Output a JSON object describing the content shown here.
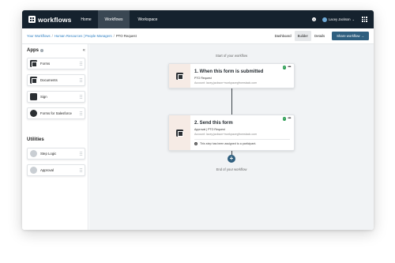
{
  "topbar": {
    "logo_text": "workflows",
    "tabs": [
      {
        "label": "Home"
      },
      {
        "label": "Workflows"
      },
      {
        "label": "Workspace"
      }
    ],
    "user_name": "Lacey Jackson",
    "background": "#15222e"
  },
  "subbar": {
    "breadcrumbs": [
      {
        "label": "Your Workflows"
      },
      {
        "label": "Human Resources | People Managers"
      },
      {
        "label": "PTO Request"
      }
    ],
    "separator": "/",
    "view_tabs": [
      {
        "label": "Dashboard"
      },
      {
        "label": "Builder"
      },
      {
        "label": "Details"
      }
    ],
    "share_label": "Share workflow →"
  },
  "sidebar": {
    "apps_title": "Apps",
    "apps": [
      {
        "label": "Forms",
        "icon": "forms-icon"
      },
      {
        "label": "Documents",
        "icon": "documents-icon"
      },
      {
        "label": "Sign",
        "icon": "sign-icon"
      },
      {
        "label": "Forms for Salesforce",
        "icon": "salesforce-forms-icon"
      }
    ],
    "utilities_title": "Utilities",
    "utilities": [
      {
        "label": "Step Logic",
        "icon": "step-logic-icon"
      },
      {
        "label": "Approval",
        "icon": "approval-icon"
      }
    ]
  },
  "canvas": {
    "start_label": "Start of your workflow",
    "end_label": "End of your workflow",
    "steps": [
      {
        "title": "1. When this form is submitted",
        "subtitle": "PTO Request",
        "account": "Account: lacey.jackson+workpacegfromstack.com"
      },
      {
        "title": "2. Send this form",
        "subtitle": "Approval | PTO Request",
        "account": "Account: lacey.jackson+workpacegfromstack.com",
        "note": "This step has been assigned to a participant."
      }
    ],
    "background": "#f1f3f5",
    "accent": "#2f5f7f"
  }
}
